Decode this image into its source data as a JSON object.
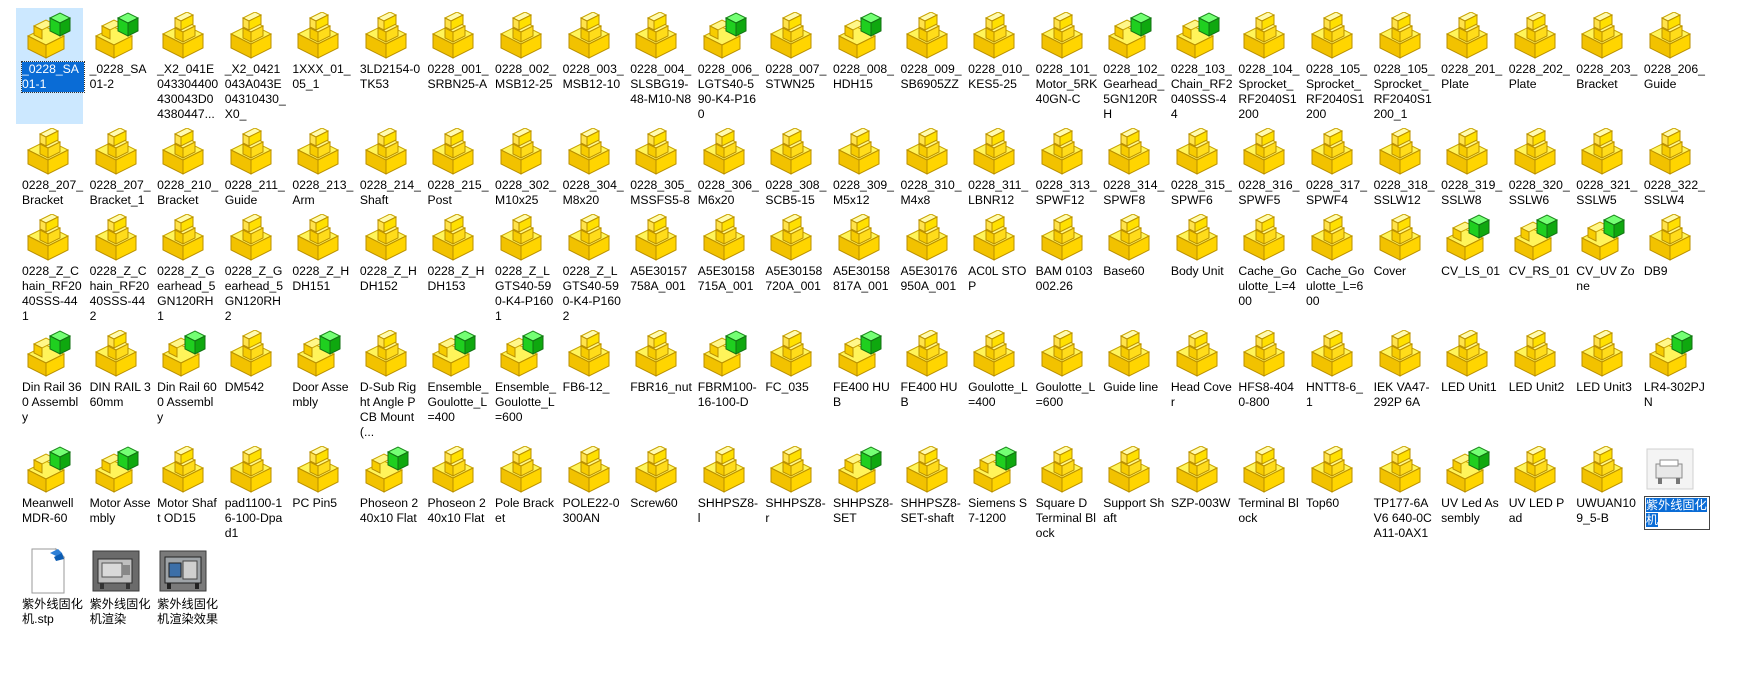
{
  "explorer": {
    "files": [
      {
        "name": "_0228_SA01-1",
        "kind": "asm"
      },
      {
        "name": "_0228_SA01-2",
        "kind": "asm"
      },
      {
        "name": "_X2_041E043304400430043D04380447...",
        "kind": "part"
      },
      {
        "name": "_X2_0421043A043E04310430_X0_",
        "kind": "part"
      },
      {
        "name": "1XXX_01_05_1",
        "kind": "part"
      },
      {
        "name": "3LD2154-0TK53",
        "kind": "part"
      },
      {
        "name": "0228_001_SRBN25-A",
        "kind": "part"
      },
      {
        "name": "0228_002_MSB12-25",
        "kind": "part"
      },
      {
        "name": "0228_003_MSB12-10",
        "kind": "part"
      },
      {
        "name": "0228_004_SLSBG19-48-M10-N8",
        "kind": "part"
      },
      {
        "name": "0228_006_LGTS40-590-K4-P160",
        "kind": "asm"
      },
      {
        "name": "0228_007_STWN25",
        "kind": "part"
      },
      {
        "name": "0228_008_HDH15",
        "kind": "asm"
      },
      {
        "name": "0228_009_SB6905ZZ",
        "kind": "part"
      },
      {
        "name": "0228_010_KES5-25",
        "kind": "part"
      },
      {
        "name": "0228_101_Motor_5RK40GN-C",
        "kind": "part"
      },
      {
        "name": "0228_102_Gearhead_5GN120RH",
        "kind": "asm"
      },
      {
        "name": "0228_103_Chain_RF2040SSS-44",
        "kind": "asm"
      },
      {
        "name": "0228_104_Sprocket_RF2040S1200",
        "kind": "part"
      },
      {
        "name": "0228_105_Sprocket_RF2040S1200",
        "kind": "part"
      },
      {
        "name": "0228_105_Sprocket_RF2040S1200_1",
        "kind": "part"
      },
      {
        "name": "0228_201_Plate",
        "kind": "part"
      },
      {
        "name": "0228_202_Plate",
        "kind": "part"
      },
      {
        "name": "0228_203_Bracket",
        "kind": "part"
      },
      {
        "name": "0228_206_Guide",
        "kind": "part"
      },
      {
        "name": "0228_207_Bracket",
        "kind": "part"
      },
      {
        "name": "0228_207_Bracket_1",
        "kind": "part"
      },
      {
        "name": "0228_210_Bracket",
        "kind": "part"
      },
      {
        "name": "0228_211_Guide",
        "kind": "part"
      },
      {
        "name": "0228_213_Arm",
        "kind": "part"
      },
      {
        "name": "0228_214_Shaft",
        "kind": "part"
      },
      {
        "name": "0228_215_Post",
        "kind": "part"
      },
      {
        "name": "0228_302_M10x25",
        "kind": "part"
      },
      {
        "name": "0228_304_M8x20",
        "kind": "part"
      },
      {
        "name": "0228_305_MSSFS5-8",
        "kind": "part"
      },
      {
        "name": "0228_306_M6x20",
        "kind": "part"
      },
      {
        "name": "0228_308_SCB5-15",
        "kind": "part"
      },
      {
        "name": "0228_309_M5x12",
        "kind": "part"
      },
      {
        "name": "0228_310_M4x8",
        "kind": "part"
      },
      {
        "name": "0228_311_LBNR12",
        "kind": "part"
      },
      {
        "name": "0228_313_SPWF12",
        "kind": "part"
      },
      {
        "name": "0228_314_SPWF8",
        "kind": "part"
      },
      {
        "name": "0228_315_SPWF6",
        "kind": "part"
      },
      {
        "name": "0228_316_SPWF5",
        "kind": "part"
      },
      {
        "name": "0228_317_SPWF4",
        "kind": "part"
      },
      {
        "name": "0228_318_SSLW12",
        "kind": "part"
      },
      {
        "name": "0228_319_SSLW8",
        "kind": "part"
      },
      {
        "name": "0228_320_SSLW6",
        "kind": "part"
      },
      {
        "name": "0228_321_SSLW5",
        "kind": "part"
      },
      {
        "name": "0228_322_SSLW4",
        "kind": "part"
      },
      {
        "name": "0228_Z_Chain_RF2040SSS-441",
        "kind": "part"
      },
      {
        "name": "0228_Z_Chain_RF2040SSS-442",
        "kind": "part"
      },
      {
        "name": "0228_Z_Gearhead_5GN120RH1",
        "kind": "part"
      },
      {
        "name": "0228_Z_Gearhead_5GN120RH2",
        "kind": "part"
      },
      {
        "name": "0228_Z_HDH151",
        "kind": "part"
      },
      {
        "name": "0228_Z_HDH152",
        "kind": "part"
      },
      {
        "name": "0228_Z_HDH153",
        "kind": "part"
      },
      {
        "name": "0228_Z_LGTS40-590-K4-P1601",
        "kind": "part"
      },
      {
        "name": "0228_Z_LGTS40-590-K4-P1602",
        "kind": "part"
      },
      {
        "name": "A5E30157758A_001",
        "kind": "part"
      },
      {
        "name": "A5E30158715A_001",
        "kind": "part"
      },
      {
        "name": "A5E30158720A_001",
        "kind": "part"
      },
      {
        "name": "A5E30158817A_001",
        "kind": "part"
      },
      {
        "name": "A5E30176950A_001",
        "kind": "part"
      },
      {
        "name": "AC0L STOP",
        "kind": "part"
      },
      {
        "name": "BAM 0103002.26",
        "kind": "part"
      },
      {
        "name": "Base60",
        "kind": "part"
      },
      {
        "name": "Body Unit",
        "kind": "part"
      },
      {
        "name": "Cache_Goulotte_L=400",
        "kind": "part"
      },
      {
        "name": "Cache_Goulotte_L=600",
        "kind": "part"
      },
      {
        "name": "Cover",
        "kind": "part"
      },
      {
        "name": "CV_LS_01",
        "kind": "asm"
      },
      {
        "name": "CV_RS_01",
        "kind": "asm"
      },
      {
        "name": "CV_UV Zone",
        "kind": "asm"
      },
      {
        "name": "DB9",
        "kind": "part"
      },
      {
        "name": "Din Rail 360 Assembly",
        "kind": "asm"
      },
      {
        "name": "DIN RAIL 360mm",
        "kind": "part"
      },
      {
        "name": "Din Rail 600 Assembly",
        "kind": "asm"
      },
      {
        "name": "DM542",
        "kind": "part"
      },
      {
        "name": "Door Assembly",
        "kind": "asm"
      },
      {
        "name": "D-Sub Right Angle PCB Mount (...",
        "kind": "part"
      },
      {
        "name": "Ensemble_Goulotte_L=400",
        "kind": "asm"
      },
      {
        "name": "Ensemble_Goulotte_L=600",
        "kind": "asm"
      },
      {
        "name": "FB6-12_",
        "kind": "part"
      },
      {
        "name": "FBR16_nut",
        "kind": "part"
      },
      {
        "name": "FBRM100-16-100-D",
        "kind": "asm"
      },
      {
        "name": "FC_035",
        "kind": "part"
      },
      {
        "name": "FE400 HUB",
        "kind": "asm"
      },
      {
        "name": "FE400 HUB",
        "kind": "part"
      },
      {
        "name": "Goulotte_L=400",
        "kind": "part"
      },
      {
        "name": "Goulotte_L=600",
        "kind": "part"
      },
      {
        "name": "Guide line",
        "kind": "part"
      },
      {
        "name": "Head Cover",
        "kind": "part"
      },
      {
        "name": "HFS8-4040-800",
        "kind": "part"
      },
      {
        "name": "HNTT8-6_1",
        "kind": "part"
      },
      {
        "name": "IEK VA47-292P 6A",
        "kind": "part"
      },
      {
        "name": "LED Unit1",
        "kind": "part"
      },
      {
        "name": "LED Unit2",
        "kind": "part"
      },
      {
        "name": "LED Unit3",
        "kind": "part"
      },
      {
        "name": "LR4-302PJN",
        "kind": "asm"
      },
      {
        "name": "Meanwell MDR-60",
        "kind": "asm"
      },
      {
        "name": "Motor Assembly",
        "kind": "asm"
      },
      {
        "name": "Motor Shaft OD15",
        "kind": "part"
      },
      {
        "name": "pad1100-16-100-Dpad1",
        "kind": "part"
      },
      {
        "name": "PC Pin5",
        "kind": "part"
      },
      {
        "name": "Phoseon 240x10 Flat",
        "kind": "asm"
      },
      {
        "name": "Phoseon 240x10 Flat",
        "kind": "part"
      },
      {
        "name": "Pole Bracket",
        "kind": "part"
      },
      {
        "name": "POLE22-0300AN",
        "kind": "part"
      },
      {
        "name": "Screw60",
        "kind": "part"
      },
      {
        "name": "SHHPSZ8-l",
        "kind": "part"
      },
      {
        "name": "SHHPSZ8-r",
        "kind": "part"
      },
      {
        "name": "SHHPSZ8-SET",
        "kind": "asm"
      },
      {
        "name": "SHHPSZ8-SET-shaft",
        "kind": "part"
      },
      {
        "name": "Siemens S7-1200",
        "kind": "asm"
      },
      {
        "name": "Square D Terminal Block",
        "kind": "part"
      },
      {
        "name": "Support Shaft",
        "kind": "part"
      },
      {
        "name": "SZP-003W",
        "kind": "part"
      },
      {
        "name": "Terminal Block",
        "kind": "part"
      },
      {
        "name": "Top60",
        "kind": "part"
      },
      {
        "name": "TP177-6A V6 640-0CA11-0AX1",
        "kind": "part"
      },
      {
        "name": "UV Led Assembly",
        "kind": "asm"
      },
      {
        "name": "UV LED Pad",
        "kind": "part"
      },
      {
        "name": "UWUAN109_5-B",
        "kind": "part"
      },
      {
        "name": "紫外线固化机",
        "kind": "sldasm",
        "renaming": true
      },
      {
        "name": "紫外线固化机.stp",
        "kind": "stp"
      },
      {
        "name": "紫外线固化机渲染",
        "kind": "render"
      },
      {
        "name": "紫外线固化机渲染效果",
        "kind": "render2"
      }
    ],
    "selected_index": 0
  }
}
